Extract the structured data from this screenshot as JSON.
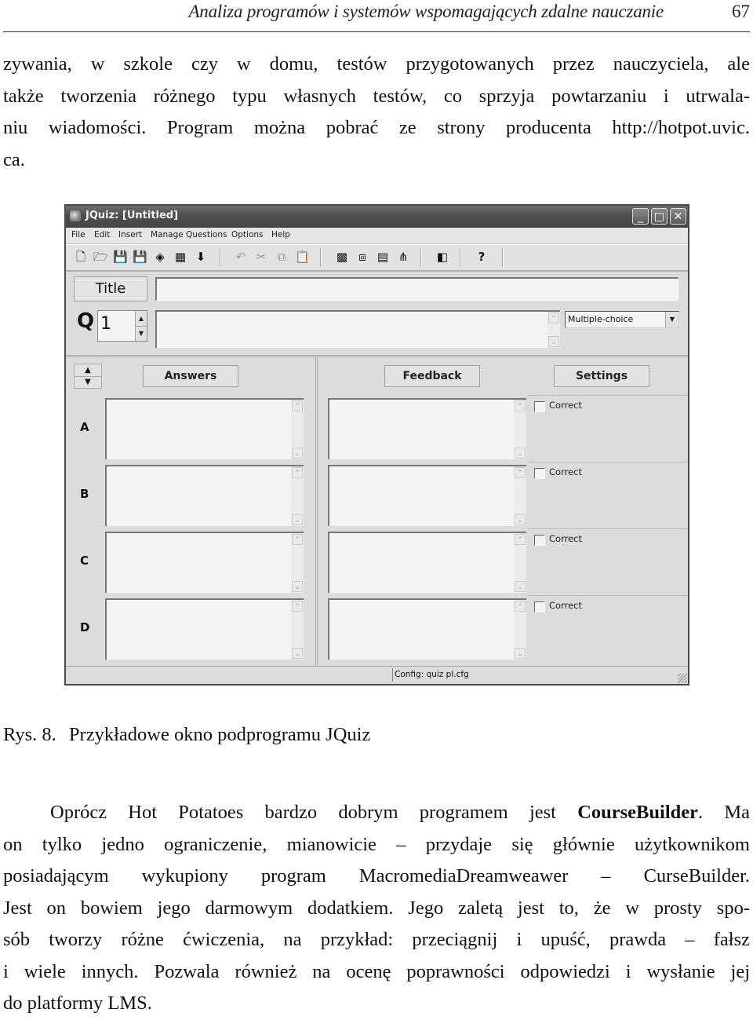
{
  "running_head": {
    "title": "Analiza programów i systemów wspomagających zdalne nauczanie",
    "page_number": "67"
  },
  "paragraph_1": {
    "lines": [
      "zywania, w szkole czy w domu, testów przygotowanych przez nauczyciela, ale",
      "także tworzenia różnego typu własnych testów, co sprzyja powtarzaniu i utrwala-",
      "niu wiadomości. Program można pobrać ze strony producenta http://hotpot.uvic.",
      "ca."
    ]
  },
  "figure": {
    "caption_number": "Rys. 8.",
    "caption_text": "Przykładowe okno podprogramu JQuiz",
    "window": {
      "title": "JQuiz: [Untitled]",
      "controls": {
        "minimize": "_",
        "maximize": "□",
        "close": "✕"
      },
      "menu": [
        "File",
        "Edit",
        "Insert",
        "Manage Questions",
        "Options",
        "Help"
      ],
      "toolbar": [
        {
          "icon": "new-file-icon",
          "glyph": "🗋",
          "enabled": true
        },
        {
          "icon": "open-folder-icon",
          "glyph": "🗁",
          "enabled": true
        },
        {
          "icon": "save-icon",
          "glyph": "💾",
          "enabled": true
        },
        {
          "icon": "save-as-icon",
          "glyph": "💾",
          "enabled": true
        },
        {
          "icon": "web-page-icon",
          "glyph": "◈",
          "enabled": true
        },
        {
          "icon": "export-icon",
          "glyph": "▦",
          "enabled": true
        },
        {
          "icon": "download-arrow-icon",
          "glyph": "⬇",
          "enabled": true
        },
        {
          "icon": "undo-icon",
          "glyph": "↶",
          "enabled": false
        },
        {
          "icon": "cut-icon",
          "glyph": "✂",
          "enabled": false
        },
        {
          "icon": "copy-icon",
          "glyph": "⧉",
          "enabled": false
        },
        {
          "icon": "paste-icon",
          "glyph": "📋",
          "enabled": false
        },
        {
          "icon": "add-picture-icon",
          "glyph": "▩",
          "enabled": true
        },
        {
          "icon": "insert-media-icon",
          "glyph": "⧈",
          "enabled": true
        },
        {
          "icon": "export-web-icon",
          "glyph": "▤",
          "enabled": true
        },
        {
          "icon": "export-tree-icon",
          "glyph": "⋔",
          "enabled": true
        },
        {
          "icon": "config-icon",
          "glyph": "◧",
          "enabled": true
        },
        {
          "icon": "help-icon",
          "glyph": "?",
          "enabled": true
        }
      ],
      "title_button": "Title",
      "title_value": "",
      "question_label": "Q",
      "question_number": "1",
      "question_text": "",
      "question_type": "Multiple-choice",
      "columns": {
        "answers": "Answers",
        "feedback": "Feedback",
        "settings": "Settings"
      },
      "rows": [
        {
          "letter": "A",
          "answer": "",
          "feedback": "",
          "correct_label": "Correct",
          "correct": false
        },
        {
          "letter": "B",
          "answer": "",
          "feedback": "",
          "correct_label": "Correct",
          "correct": false
        },
        {
          "letter": "C",
          "answer": "",
          "feedback": "",
          "correct_label": "Correct",
          "correct": false
        },
        {
          "letter": "D",
          "answer": "",
          "feedback": "",
          "correct_label": "Correct",
          "correct": false
        }
      ],
      "status": "Config: quiz pl.cfg"
    }
  },
  "paragraph_2": {
    "lines": [
      [
        "Oprócz Hot Potatoes bardzo dobrym programem jest ",
        "CourseBuilder",
        ". Ma"
      ],
      "on tylko jedno ograniczenie, mianowicie – przydaje się głównie użytkownikom",
      "posiadającym wykupiony program MacromediaDreamweawer – CurseBuilder.",
      "Jest on bowiem jego darmowym dodatkiem. Jego zaletą jest to, że w prosty spo-",
      "sób tworzy różne ćwiczenia, na przykład: przeciągnij i upuść, prawda – fałsz",
      "i wiele innych. Pozwala również na ocenę poprawności odpowiedzi i wysłanie jej",
      "do platformy LMS."
    ]
  }
}
